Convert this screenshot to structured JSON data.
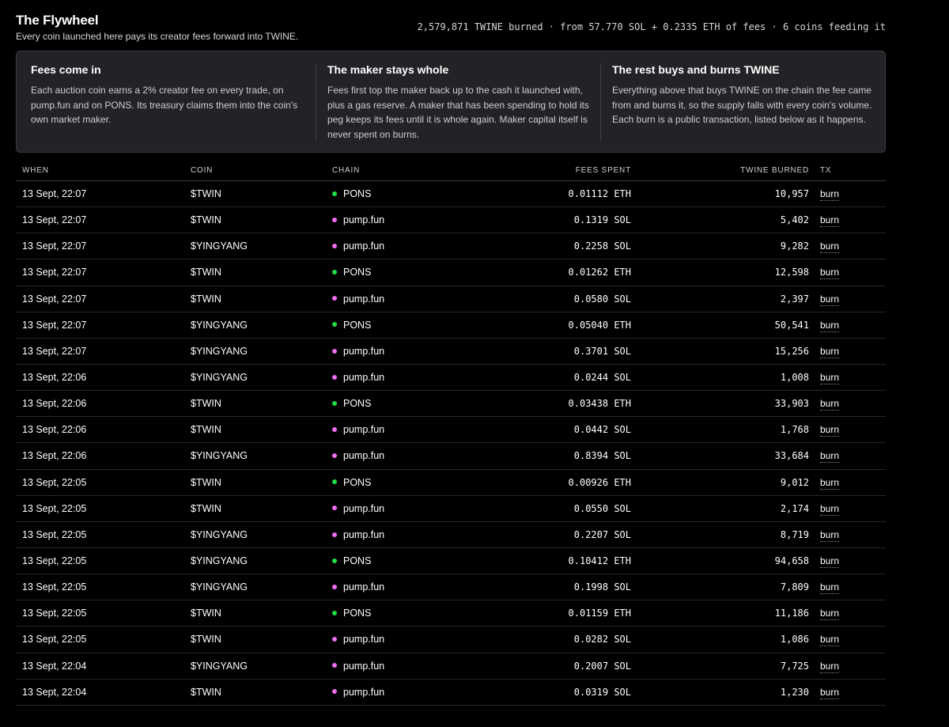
{
  "header": {
    "title": "The Flywheel",
    "subtitle": "Every coin launched here pays its creator fees forward into TWINE.",
    "stats": "2,579,871 TWINE burned · from 57.770 SOL + 0.2335 ETH of fees · 6 coins feeding it"
  },
  "info": [
    {
      "title": "Fees come in",
      "text": "Each auction coin earns a 2% creator fee on every trade, on pump.fun and on PONS. Its treasury claims them into the coin's own market maker."
    },
    {
      "title": "The maker stays whole",
      "text": "Fees first top the maker back up to the cash it launched with, plus a gas reserve. A maker that has been spending to hold its peg keeps its fees until it is whole again. Maker capital itself is never spent on burns."
    },
    {
      "title": "The rest buys and burns TWINE",
      "text": "Everything above that buys TWINE on the chain the fee came from and burns it, so the supply falls with every coin's volume. Each burn is a public transaction, listed below as it happens."
    }
  ],
  "colors": {
    "pons": "#22dd44",
    "pump": "#f06ef0",
    "panel": "#232327"
  },
  "table": {
    "headers": {
      "when": "WHEN",
      "coin": "COIN",
      "chain": "CHAIN",
      "fees": "FEES SPENT",
      "burned": "TWINE BURNED",
      "tx": "TX"
    },
    "rows": [
      {
        "when": "13 Sept, 22:07",
        "coin": "$TWIN",
        "chain": "PONS",
        "fees": "0.01112 ETH",
        "burned": "10,957",
        "tx": "burn"
      },
      {
        "when": "13 Sept, 22:07",
        "coin": "$TWIN",
        "chain": "pump.fun",
        "fees": "0.1319 SOL",
        "burned": "5,402",
        "tx": "burn"
      },
      {
        "when": "13 Sept, 22:07",
        "coin": "$YINGYANG",
        "chain": "pump.fun",
        "fees": "0.2258 SOL",
        "burned": "9,282",
        "tx": "burn"
      },
      {
        "when": "13 Sept, 22:07",
        "coin": "$TWIN",
        "chain": "PONS",
        "fees": "0.01262 ETH",
        "burned": "12,598",
        "tx": "burn"
      },
      {
        "when": "13 Sept, 22:07",
        "coin": "$TWIN",
        "chain": "pump.fun",
        "fees": "0.0580 SOL",
        "burned": "2,397",
        "tx": "burn"
      },
      {
        "when": "13 Sept, 22:07",
        "coin": "$YINGYANG",
        "chain": "PONS",
        "fees": "0.05040 ETH",
        "burned": "50,541",
        "tx": "burn"
      },
      {
        "when": "13 Sept, 22:07",
        "coin": "$YINGYANG",
        "chain": "pump.fun",
        "fees": "0.3701 SOL",
        "burned": "15,256",
        "tx": "burn"
      },
      {
        "when": "13 Sept, 22:06",
        "coin": "$YINGYANG",
        "chain": "pump.fun",
        "fees": "0.0244 SOL",
        "burned": "1,008",
        "tx": "burn"
      },
      {
        "when": "13 Sept, 22:06",
        "coin": "$TWIN",
        "chain": "PONS",
        "fees": "0.03438 ETH",
        "burned": "33,903",
        "tx": "burn"
      },
      {
        "when": "13 Sept, 22:06",
        "coin": "$TWIN",
        "chain": "pump.fun",
        "fees": "0.0442 SOL",
        "burned": "1,768",
        "tx": "burn"
      },
      {
        "when": "13 Sept, 22:06",
        "coin": "$YINGYANG",
        "chain": "pump.fun",
        "fees": "0.8394 SOL",
        "burned": "33,684",
        "tx": "burn"
      },
      {
        "when": "13 Sept, 22:05",
        "coin": "$TWIN",
        "chain": "PONS",
        "fees": "0.00926 ETH",
        "burned": "9,012",
        "tx": "burn"
      },
      {
        "when": "13 Sept, 22:05",
        "coin": "$TWIN",
        "chain": "pump.fun",
        "fees": "0.0550 SOL",
        "burned": "2,174",
        "tx": "burn"
      },
      {
        "when": "13 Sept, 22:05",
        "coin": "$YINGYANG",
        "chain": "pump.fun",
        "fees": "0.2207 SOL",
        "burned": "8,719",
        "tx": "burn"
      },
      {
        "when": "13 Sept, 22:05",
        "coin": "$YINGYANG",
        "chain": "PONS",
        "fees": "0.10412 ETH",
        "burned": "94,658",
        "tx": "burn"
      },
      {
        "when": "13 Sept, 22:05",
        "coin": "$YINGYANG",
        "chain": "pump.fun",
        "fees": "0.1998 SOL",
        "burned": "7,809",
        "tx": "burn"
      },
      {
        "when": "13 Sept, 22:05",
        "coin": "$TWIN",
        "chain": "PONS",
        "fees": "0.01159 ETH",
        "burned": "11,186",
        "tx": "burn"
      },
      {
        "when": "13 Sept, 22:05",
        "coin": "$TWIN",
        "chain": "pump.fun",
        "fees": "0.0282 SOL",
        "burned": "1,086",
        "tx": "burn"
      },
      {
        "when": "13 Sept, 22:04",
        "coin": "$YINGYANG",
        "chain": "pump.fun",
        "fees": "0.2007 SOL",
        "burned": "7,725",
        "tx": "burn"
      },
      {
        "when": "13 Sept, 22:04",
        "coin": "$TWIN",
        "chain": "pump.fun",
        "fees": "0.0319 SOL",
        "burned": "1,230",
        "tx": "burn"
      }
    ]
  }
}
